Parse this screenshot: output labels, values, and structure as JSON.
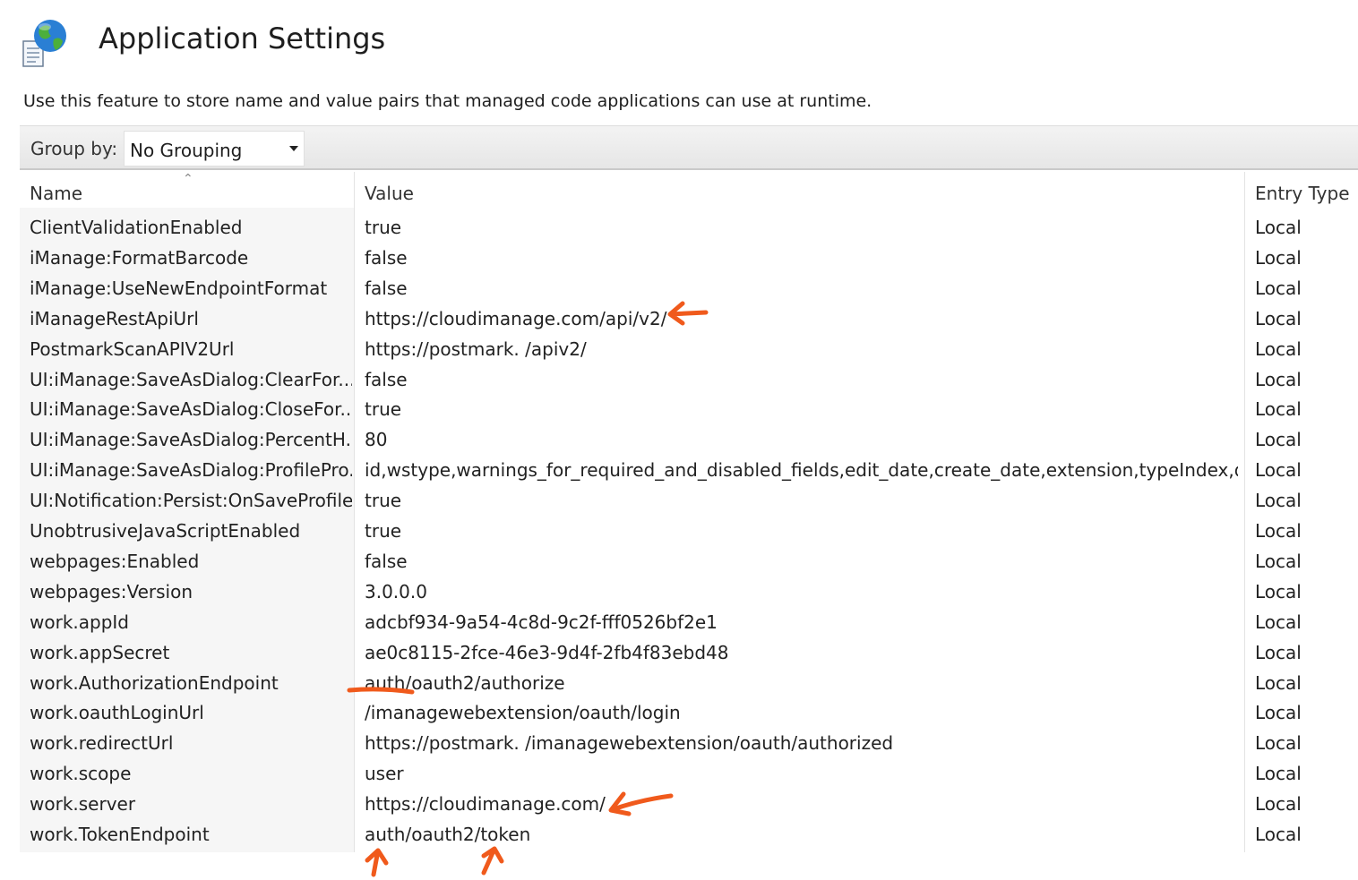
{
  "page": {
    "title": "Application Settings",
    "description": "Use this feature to store name and value pairs that managed code applications can use at runtime."
  },
  "toolbar": {
    "group_by_label": "Group by:",
    "group_by_value": "No Grouping"
  },
  "table": {
    "columns": [
      "Name",
      "Value",
      "Entry Type"
    ],
    "sort_column": "Name",
    "rows": [
      {
        "name": "ClientValidationEnabled",
        "value": "true",
        "type": "Local"
      },
      {
        "name": "iManage:FormatBarcode",
        "value": "false",
        "type": "Local"
      },
      {
        "name": "iManage:UseNewEndpointFormat",
        "value": "false",
        "type": "Local"
      },
      {
        "name": "iManageRestApiUrl",
        "value": "https://cloudimanage.com/api/v2/",
        "type": "Local"
      },
      {
        "name": "PostmarkScanAPIV2Url",
        "value": "https://postmark.                         /apiv2/",
        "type": "Local"
      },
      {
        "name": "UI:iManage:SaveAsDialog:ClearFor...",
        "value": "false",
        "type": "Local"
      },
      {
        "name": "UI:iManage:SaveAsDialog:CloseFor...",
        "value": "true",
        "type": "Local"
      },
      {
        "name": "UI:iManage:SaveAsDialog:PercentH...",
        "value": "80",
        "type": "Local"
      },
      {
        "name": "UI:iManage:SaveAsDialog:ProfilePro...",
        "value": "id,wstype,warnings_for_required_and_disabled_fields,edit_date,create_date,extension,typeIndex,docu...",
        "type": "Local"
      },
      {
        "name": "UI:Notification:Persist:OnSaveProfile...",
        "value": "true",
        "type": "Local"
      },
      {
        "name": "UnobtrusiveJavaScriptEnabled",
        "value": "true",
        "type": "Local"
      },
      {
        "name": "webpages:Enabled",
        "value": "false",
        "type": "Local"
      },
      {
        "name": "webpages:Version",
        "value": "3.0.0.0",
        "type": "Local"
      },
      {
        "name": "work.appId",
        "value": "adcbf934-9a54-4c8d-9c2f-fff0526bf2e1",
        "type": "Local"
      },
      {
        "name": "work.appSecret",
        "value": "ae0c8115-2fce-46e3-9d4f-2fb4f83ebd48",
        "type": "Local"
      },
      {
        "name": "work.AuthorizationEndpoint",
        "value": "auth/oauth2/authorize",
        "type": "Local"
      },
      {
        "name": "work.oauthLoginUrl",
        "value": "/imanagewebextension/oauth/login",
        "type": "Local"
      },
      {
        "name": "work.redirectUrl",
        "value": "https://postmark.                       /imanagewebextension/oauth/authorized",
        "type": "Local"
      },
      {
        "name": "work.scope",
        "value": "user",
        "type": "Local"
      },
      {
        "name": "work.server",
        "value": "https://cloudimanage.com/",
        "type": "Local"
      },
      {
        "name": "work.TokenEndpoint",
        "value": "auth/oauth2/token",
        "type": "Local"
      }
    ]
  },
  "icons": {
    "app": "globe-document-icon",
    "dropdown": "chevron-down-icon",
    "sort": "sort-ascending-icon"
  },
  "colors": {
    "annotation": "#f05a1c",
    "name_column_bg": "#f6f6f6",
    "toolbar_bg": "#ececec"
  }
}
